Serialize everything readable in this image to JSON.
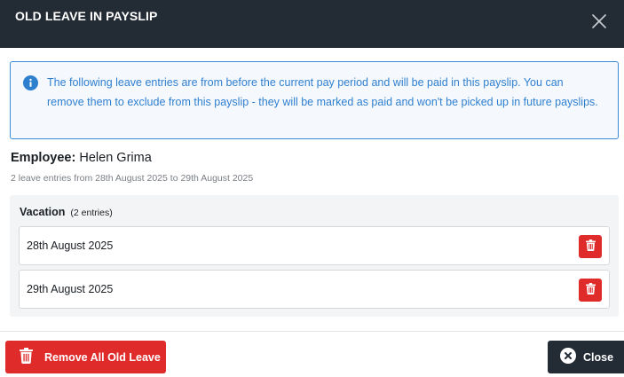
{
  "modal": {
    "title": "OLD LEAVE IN PAYSLIP"
  },
  "alert": {
    "message": "The following leave entries are from before the current pay period and will be paid in this payslip. You can remove them to exclude from this payslip - they will be marked as paid and won't be picked up in future payslips."
  },
  "employee": {
    "label": "Employee:",
    "name": "Helen Grima",
    "summary": "2 leave entries from 28th August 2025 to 29th August 2025"
  },
  "group": {
    "title": "Vacation",
    "count": "(2 entries)",
    "entries": [
      {
        "date": "28th August 2025"
      },
      {
        "date": "29th August 2025"
      }
    ]
  },
  "footer": {
    "remove_all_label": "Remove All Old Leave",
    "close_label": "Close"
  },
  "colors": {
    "header_bg": "#232b34",
    "info": "#2f7fcf",
    "danger": "#e02b2b"
  }
}
